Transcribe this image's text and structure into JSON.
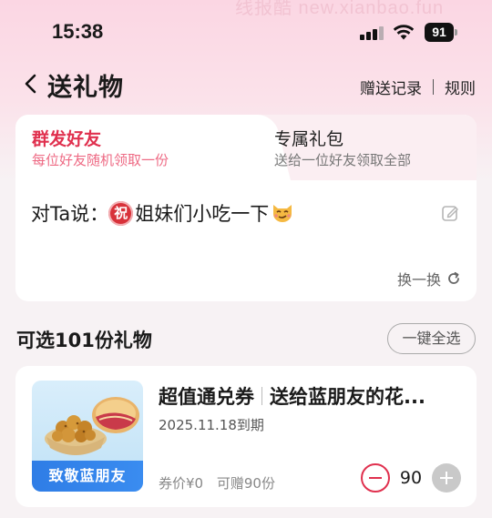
{
  "status_bar": {
    "time": "15:38",
    "battery_level": "91",
    "signal_bars_on": 3,
    "signal_bars_total": 4,
    "watermark": "线报酷 new.xianbao.fun"
  },
  "nav": {
    "title": "送礼物",
    "records_label": "赠送记录",
    "rules_label": "规则"
  },
  "tabs": [
    {
      "title": "群发好友",
      "subtitle": "每位好友随机领取一份",
      "active": true
    },
    {
      "title": "专属礼包",
      "subtitle": "送给一位好友领取全部",
      "active": false
    }
  ],
  "message": {
    "prefix": "对Ta说：",
    "badge": "祝",
    "text": "姐妹们小吃一下",
    "emoji": "smirking-cat-emoji"
  },
  "refresh_label": "换一换",
  "section": {
    "title": "可选101份礼物",
    "select_all_label": "一键全选"
  },
  "gift": {
    "image_label": "致敬蓝朋友",
    "title_left": "超值通兑券",
    "title_right": "送给蓝朋友的花...",
    "expiry": "2025.11.18到期",
    "price": "券价¥0",
    "giftable": "可赠90份",
    "quantity": "90"
  },
  "colors": {
    "accent": "#e0304e",
    "accent_light": "#ee6a84",
    "header_gradient_top": "#fbd6e3",
    "page_bg": "#f7f2f4",
    "ribbon_blue": "#2f7de6"
  }
}
